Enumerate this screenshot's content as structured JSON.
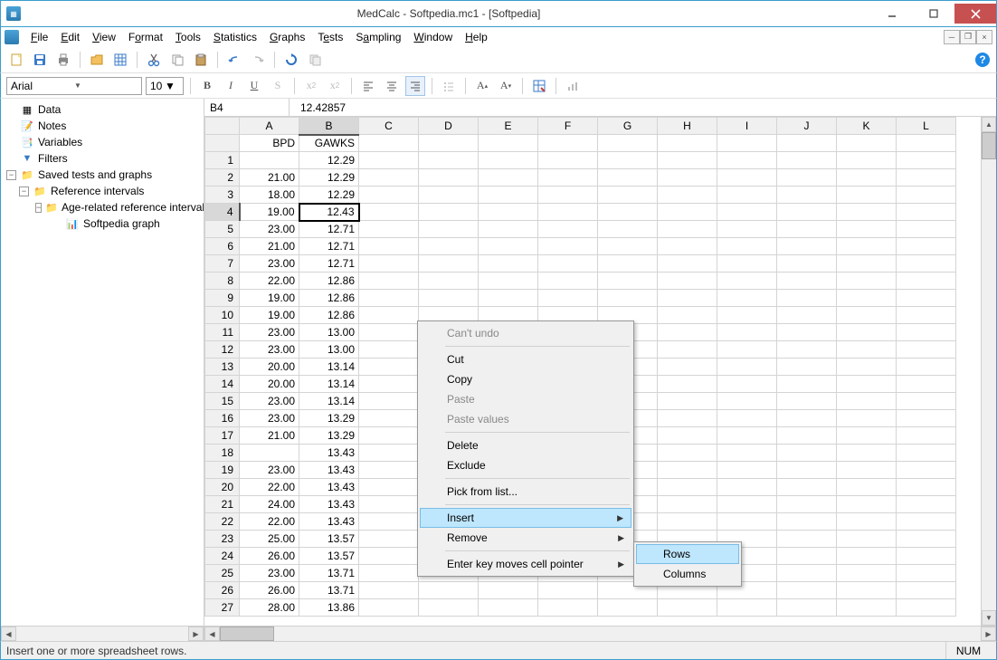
{
  "window": {
    "title": "MedCalc - Softpedia.mc1 - [Softpedia]"
  },
  "menu": {
    "file": "File",
    "edit": "Edit",
    "view": "View",
    "format": "Format",
    "tools": "Tools",
    "statistics": "Statistics",
    "graphs": "Graphs",
    "tests": "Tests",
    "sampling": "Sampling",
    "window": "Window",
    "help": "Help"
  },
  "font": {
    "name": "Arial",
    "size": "10"
  },
  "tree": {
    "data": "Data",
    "notes": "Notes",
    "variables": "Variables",
    "filters": "Filters",
    "saved": "Saved tests and graphs",
    "ref": "Reference intervals",
    "age": "Age-related reference interval",
    "graph": "Softpedia graph"
  },
  "cellref": {
    "addr": "B4",
    "value": "12.42857"
  },
  "columns": [
    "A",
    "B",
    "C",
    "D",
    "E",
    "F",
    "G",
    "H",
    "I",
    "J",
    "K",
    "L"
  ],
  "headers": {
    "A": "BPD",
    "B": "GAWKS"
  },
  "rows": [
    {
      "n": 1,
      "A": "",
      "B": "12.29"
    },
    {
      "n": 2,
      "A": "21.00",
      "B": "12.29"
    },
    {
      "n": 3,
      "A": "18.00",
      "B": "12.29"
    },
    {
      "n": 4,
      "A": "19.00",
      "B": "12.43"
    },
    {
      "n": 5,
      "A": "23.00",
      "B": "12.71"
    },
    {
      "n": 6,
      "A": "21.00",
      "B": "12.71"
    },
    {
      "n": 7,
      "A": "23.00",
      "B": "12.71"
    },
    {
      "n": 8,
      "A": "22.00",
      "B": "12.86"
    },
    {
      "n": 9,
      "A": "19.00",
      "B": "12.86"
    },
    {
      "n": 10,
      "A": "19.00",
      "B": "12.86"
    },
    {
      "n": 11,
      "A": "23.00",
      "B": "13.00"
    },
    {
      "n": 12,
      "A": "23.00",
      "B": "13.00"
    },
    {
      "n": 13,
      "A": "20.00",
      "B": "13.14"
    },
    {
      "n": 14,
      "A": "20.00",
      "B": "13.14"
    },
    {
      "n": 15,
      "A": "23.00",
      "B": "13.14"
    },
    {
      "n": 16,
      "A": "23.00",
      "B": "13.29"
    },
    {
      "n": 17,
      "A": "21.00",
      "B": "13.29"
    },
    {
      "n": 18,
      "A": "",
      "B": "13.43"
    },
    {
      "n": 19,
      "A": "23.00",
      "B": "13.43"
    },
    {
      "n": 20,
      "A": "22.00",
      "B": "13.43"
    },
    {
      "n": 21,
      "A": "24.00",
      "B": "13.43"
    },
    {
      "n": 22,
      "A": "22.00",
      "B": "13.43"
    },
    {
      "n": 23,
      "A": "25.00",
      "B": "13.57"
    },
    {
      "n": 24,
      "A": "26.00",
      "B": "13.57"
    },
    {
      "n": 25,
      "A": "23.00",
      "B": "13.71"
    },
    {
      "n": 26,
      "A": "26.00",
      "B": "13.71"
    },
    {
      "n": 27,
      "A": "28.00",
      "B": "13.86"
    }
  ],
  "contextmenu": {
    "cant_undo": "Can't undo",
    "cut": "Cut",
    "copy": "Copy",
    "paste": "Paste",
    "paste_values": "Paste values",
    "delete": "Delete",
    "exclude": "Exclude",
    "pick": "Pick from list...",
    "insert": "Insert",
    "remove": "Remove",
    "enter_key": "Enter key moves cell pointer"
  },
  "submenu": {
    "rows": "Rows",
    "columns": "Columns"
  },
  "status": {
    "text": "Insert one or more spreadsheet rows.",
    "num": "NUM"
  }
}
